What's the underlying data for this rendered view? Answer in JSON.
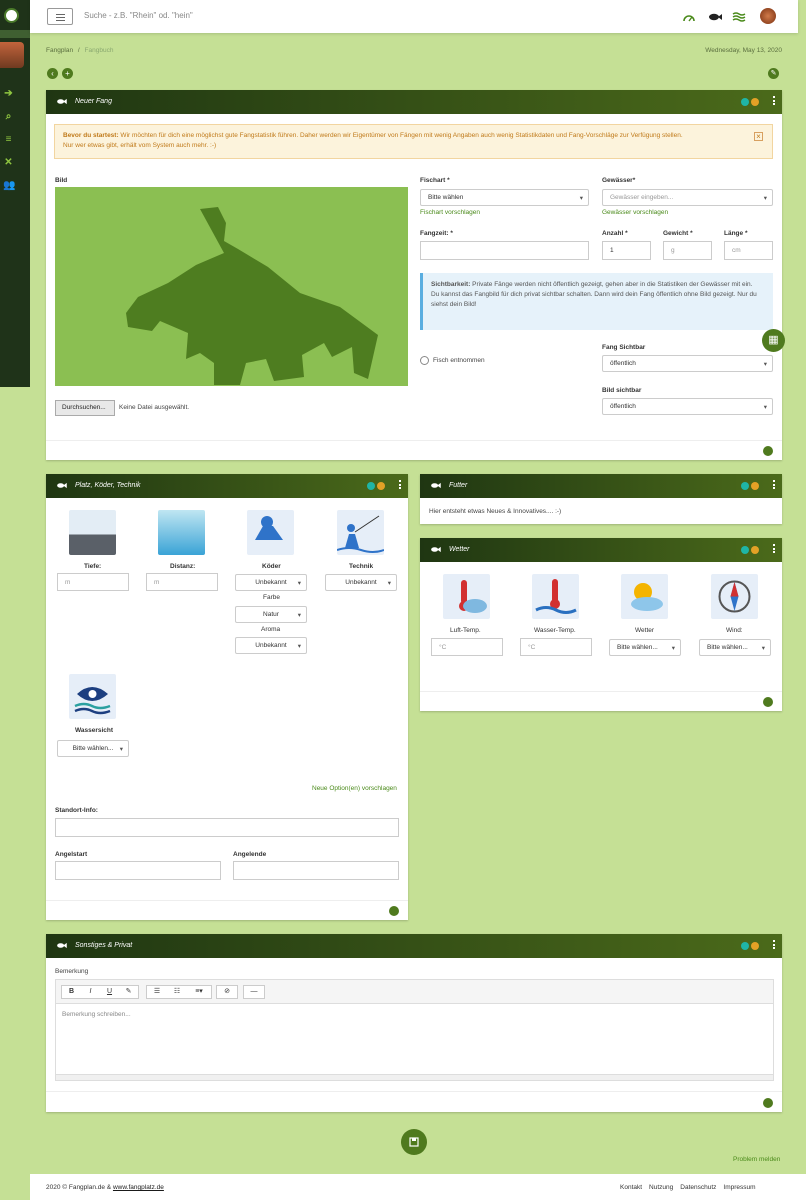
{
  "topbar": {
    "search_placeholder": "Suche - z.B. \"Rhein\" od. \"hein\""
  },
  "breadcrumb": {
    "home": "Fangplan",
    "sep": "/",
    "current": "Fangbuch"
  },
  "date": "Wednesday, May 13, 2020",
  "neuer": {
    "title": "Neuer Fang",
    "alert_bold": "Bevor du startest:",
    "alert_text": " Wir möchten für dich eine möglichst gute Fangstatistik führen. Daher werden wir Eigentümer von Fängen mit wenig Angaben auch wenig Statistikdaten und Fang-Vorschläge zur Verfügung stellen.",
    "alert_text2": "Nur wer etwas gibt, erhält vom System auch mehr. :-)",
    "alert_close": "×",
    "bild": "Bild",
    "browse": "Durchsuchen...",
    "nofile": "Keine Datei ausgewählt.",
    "fischart": "Fischart *",
    "fischart_value": "Bitte wählen",
    "fischart_suggest": "Fischart vorschlagen",
    "gewaesser": "Gewässer*",
    "gewaesser_ph": "Gewässer eingeben...",
    "gewaesser_suggest": "Gewässer vorschlagen",
    "fangzeit": "Fangzeit: *",
    "anzahl": "Anzahl *",
    "anzahl_value": "1",
    "gewicht": "Gewicht *",
    "gewicht_ph": "g",
    "laenge": "Länge *",
    "laenge_ph": "cm",
    "sicht_bold": "Sichtbarkeit:",
    "sicht_text": " Private Fänge werden nicht öffentlich gezeigt, gehen aber in die Statistiken der Gewässer mit ein.",
    "sicht_text2": "Du kannst das Fangbild für dich privat sichtbar schalten. Dann wird dein Fang öffentlich ohne Bild gezeigt. Nur du siehst dein Bild!",
    "entnommen": "Fisch entnommen",
    "fang_sichtbar": "Fang Sichtbar",
    "fang_sichtbar_value": "öffentlich",
    "bild_sichtbar": "Bild sichtbar",
    "bild_sichtbar_value": "öffentlich"
  },
  "platz": {
    "title": "Platz, Köder, Technik",
    "tiefe": "Tiefe:",
    "tiefe_ph": "m",
    "distanz": "Distanz:",
    "distanz_ph": "m",
    "koeder": "Köder",
    "koeder_value": "Unbekannt",
    "farbe": "Farbe",
    "farbe_value": "Natur",
    "aroma": "Aroma",
    "aroma_value": "Unbekannt",
    "technik": "Technik",
    "technik_value": "Unbekannt",
    "wassersicht": "Wassersicht",
    "wassersicht_value": "Bitte wählen...",
    "suggest": "Neue Option(en) vorschlagen",
    "standort": "Standort-Info:",
    "angelstart": "Angelstart",
    "angelende": "Angelende"
  },
  "futter": {
    "title": "Futter",
    "text": "Hier entsteht etwas Neues & Innovatives.... :-)"
  },
  "wetter": {
    "title": "Wetter",
    "luft": "Luft-Temp.",
    "luft_ph": "°C",
    "wasser": "Wasser-Temp.",
    "wasser_ph": "°C",
    "wetter": "Wetter",
    "wetter_value": "Bitte wählen...",
    "wind": "Wind:",
    "wind_value": "Bitte wählen..."
  },
  "sonstiges": {
    "title": "Sonstiges & Privat",
    "bemerkung": "Bemerkung",
    "bemerkung_ph": "Bemerkung schreiben...",
    "tb_bold": "B",
    "tb_italic": "I",
    "tb_underline": "U",
    "tb_eraser": "✎",
    "tb_ul": "☰",
    "tb_ol": "☷",
    "tb_align": "≡▾",
    "tb_link": "⊘",
    "tb_hr": "—"
  },
  "problem": "Problem melden",
  "footer": {
    "copy": "2020 © Fangplan.de & ",
    "link": "www.fangplatz.de",
    "kontakt": "Kontakt",
    "nutzung": "Nutzung",
    "datenschutz": "Datenschutz",
    "impressum": "Impressum"
  },
  "colors": {
    "header_dark": "#1f3612",
    "accent": "#4f7a1e",
    "dot_teal": "#1fb5a6",
    "dot_orange": "#e3a126",
    "bg": "#c5e095"
  }
}
